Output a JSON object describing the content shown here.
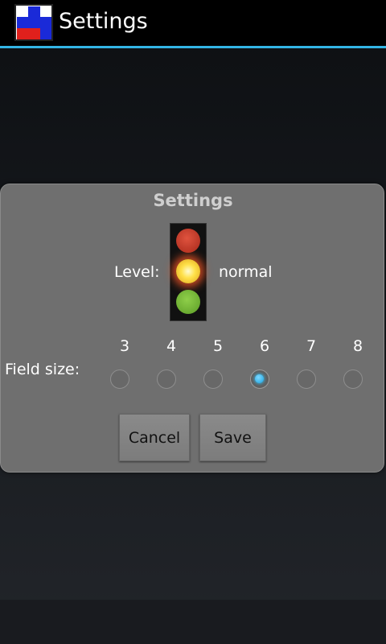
{
  "action_bar": {
    "title": "Settings",
    "accent_color": "#33b5e5"
  },
  "dialog": {
    "title": "Settings",
    "level_label": "Level:",
    "level_value": "normal",
    "traffic_light": {
      "active_lamp": "yellow"
    },
    "field_size_label": "Field size:",
    "field_sizes": [
      "3",
      "4",
      "5",
      "6",
      "7",
      "8"
    ],
    "selected_field_size": "6",
    "cancel_label": "Cancel",
    "save_label": "Save"
  }
}
